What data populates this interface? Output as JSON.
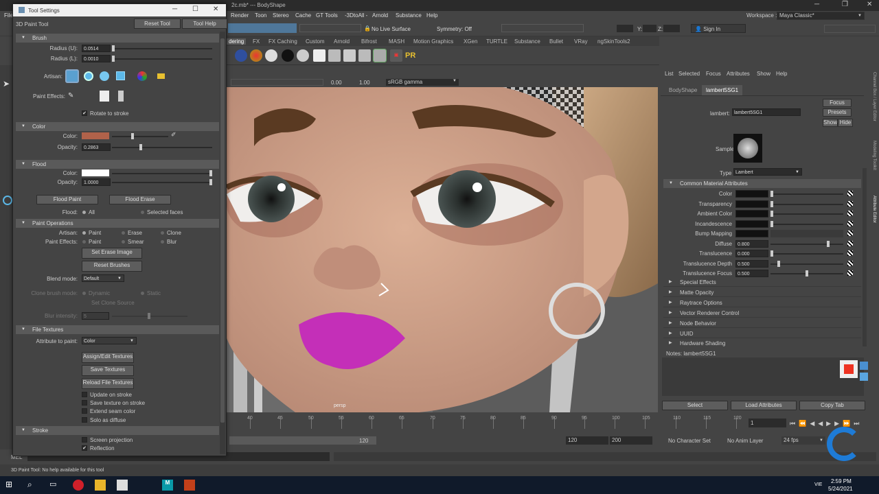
{
  "maya": {
    "title": "2c.mb* --- BodyShape",
    "menus": [
      "Render",
      "Toon",
      "Stereo",
      "Cache",
      "GT Tools",
      "-3DtoAll -",
      "Arnold",
      "Substance",
      "Help"
    ],
    "workspace_label": "Workspace :",
    "workspace_value": "Maya Classic*",
    "status": {
      "live_surface": "No Live Surface",
      "symmetry": "Symmetry: Off",
      "sign_in": "Sign In",
      "coord_y": "Y:",
      "coord_z": "Z:"
    },
    "shelf_tabs": [
      "dering",
      "FX",
      "FX Caching",
      "Custom",
      "Arnold",
      "Bifrost",
      "MASH",
      "Motion Graphics",
      "XGen",
      "TURTLE",
      "Substance",
      "Bullet",
      "VRay",
      "ngSkinTools2"
    ],
    "shelf_pr_label": "PR"
  },
  "tool_settings": {
    "window_title": "Tool Settings",
    "tool_name": "3D Paint Tool",
    "reset_tool": "Reset Tool",
    "tool_help": "Tool Help",
    "brush": {
      "header": "Brush",
      "radius_u_label": "Radius (U):",
      "radius_u_value": "0.0514",
      "radius_l_label": "Radius (L):",
      "radius_l_value": "0.0010",
      "artisan_label": "Artisan:",
      "paint_effects_label": "Paint Effects:",
      "rotate_to_stroke": "Rotate to stroke"
    },
    "color": {
      "header": "Color",
      "color_label": "Color:",
      "color_hex": "#b0624a",
      "opacity_label": "Opacity:",
      "opacity_value": "0.2863"
    },
    "flood": {
      "header": "Flood",
      "color_label": "Color:",
      "color_hex": "#ffffff",
      "opacity_label": "Opacity:",
      "opacity_value": "1.0000",
      "flood_paint": "Flood Paint",
      "flood_erase": "Flood Erase",
      "flood_label": "Flood:",
      "flood_all": "All",
      "flood_selected": "Selected faces"
    },
    "paint_ops": {
      "header": "Paint Operations",
      "artisan_label": "Artisan:",
      "artisan_paint": "Paint",
      "artisan_erase": "Erase",
      "artisan_clone": "Clone",
      "pe_label": "Paint Effects:",
      "pe_paint": "Paint",
      "pe_smear": "Smear",
      "pe_blur": "Blur",
      "set_erase_image": "Set Erase Image",
      "reset_brushes": "Reset Brushes",
      "blend_mode_label": "Blend mode:",
      "blend_mode_value": "Default",
      "clone_mode_label": "Clone brush mode:",
      "clone_dynamic": "Dynamic",
      "clone_static": "Static",
      "set_clone_source": "Set Clone Source",
      "blur_intensity_label": "Blur intensity:",
      "blur_intensity_value": "5"
    },
    "file_textures": {
      "header": "File Textures",
      "attribute_label": "Attribute to paint:",
      "attribute_value": "Color",
      "assign_edit": "Assign/Edit Textures",
      "save_textures": "Save Textures",
      "reload_textures": "Reload File Textures",
      "update_on_stroke": "Update on stroke",
      "save_on_stroke": "Save texture on stroke",
      "extend_seam": "Extend seam color",
      "solo_diffuse": "Solo as diffuse"
    },
    "stroke": {
      "header": "Stroke",
      "screen_projection": "Screen projection",
      "reflection": "Reflection"
    }
  },
  "viewport": {
    "exposure": "0.00",
    "gamma": "1.00",
    "color_space": "sRGB gamma",
    "camera": "persp"
  },
  "attribute_editor": {
    "menus": [
      "List",
      "Selected",
      "Focus",
      "Attributes",
      "Show",
      "Help"
    ],
    "tabs": [
      "BodyShape",
      "lambert5SG1"
    ],
    "focus": "Focus",
    "presets": "Presets",
    "show": "Show",
    "hide": "Hide",
    "node_label": "lambert:",
    "node_value": "lambert5SG1",
    "sample_label": "Sample",
    "type_label": "Type",
    "type_value": "Lambert",
    "common_header": "Common Material Attributes",
    "attrs": [
      {
        "label": "Color",
        "value": ""
      },
      {
        "label": "Transparency",
        "value": ""
      },
      {
        "label": "Ambient Color",
        "value": ""
      },
      {
        "label": "Incandescence",
        "value": ""
      },
      {
        "label": "Bump Mapping",
        "value": ""
      },
      {
        "label": "Diffuse",
        "value": "0.800"
      },
      {
        "label": "Translucence",
        "value": "0.000"
      },
      {
        "label": "Translucence Depth",
        "value": "0.500"
      },
      {
        "label": "Translucence Focus",
        "value": "0.500"
      }
    ],
    "collapsed": [
      "Special Effects",
      "Matte Opacity",
      "Raytrace Options",
      "Vector Renderer Control",
      "Node Behavior",
      "UUID",
      "Hardware Shading"
    ],
    "notes": "Notes: lambert5SG1",
    "select": "Select",
    "load_attributes": "Load Attributes",
    "copy_tab": "Copy Tab",
    "side_tabs": [
      "Channel Box / Layer Editor",
      "Modeling Toolkit",
      "Attribute Editor"
    ]
  },
  "time": {
    "ticks": [
      "40",
      "45",
      "50",
      "55",
      "60",
      "65",
      "70",
      "75",
      "80",
      "85",
      "90",
      "95",
      "100",
      "105",
      "110",
      "115",
      "120"
    ],
    "current_frame": "1",
    "range_end": "120",
    "anim_end": "120",
    "playback_end": "200",
    "character_set": "No Character Set",
    "anim_layer": "No Anim Layer",
    "fps": "24 fps"
  },
  "helpline": "3D Paint Tool: No help available for this tool",
  "cmd_label": "MEL",
  "taskbar": {
    "time": "2:59 PM",
    "date": "5/24/2021",
    "lang": "VIE"
  }
}
